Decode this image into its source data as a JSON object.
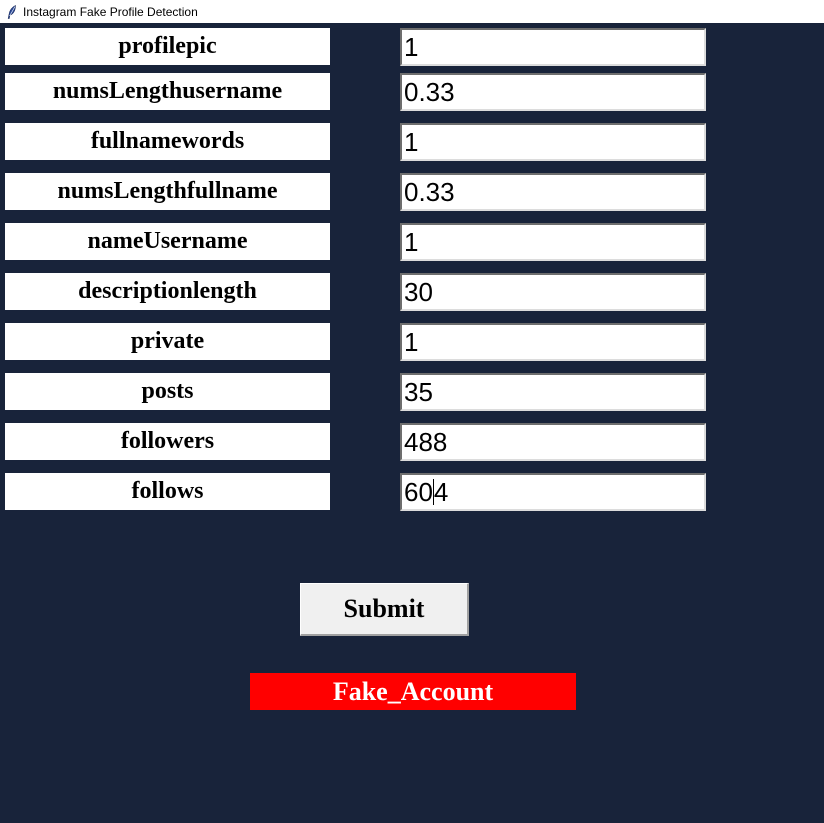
{
  "window": {
    "title": "Instagram Fake Profile Detection",
    "icon": "feather-icon"
  },
  "form": {
    "fields": [
      {
        "label": "profilepic",
        "value": "1"
      },
      {
        "label": "numsLengthusername",
        "value": "0.33"
      },
      {
        "label": "fullnamewords",
        "value": "1"
      },
      {
        "label": "numsLengthfullname",
        "value": "0.33"
      },
      {
        "label": "nameUsername",
        "value": "1"
      },
      {
        "label": "descriptionlength",
        "value": "30"
      },
      {
        "label": "private",
        "value": "1"
      },
      {
        "label": "posts",
        "value": "35"
      },
      {
        "label": "followers",
        "value": "488"
      },
      {
        "label": "follows",
        "value_before_caret": "60",
        "value_after_caret": "4"
      }
    ],
    "submit_label": "Submit",
    "result_text": "Fake_Account"
  },
  "colors": {
    "background": "#18233a",
    "result_background": "#ff0000",
    "result_text": "#ffffff",
    "button_background": "#f0f0f0"
  }
}
